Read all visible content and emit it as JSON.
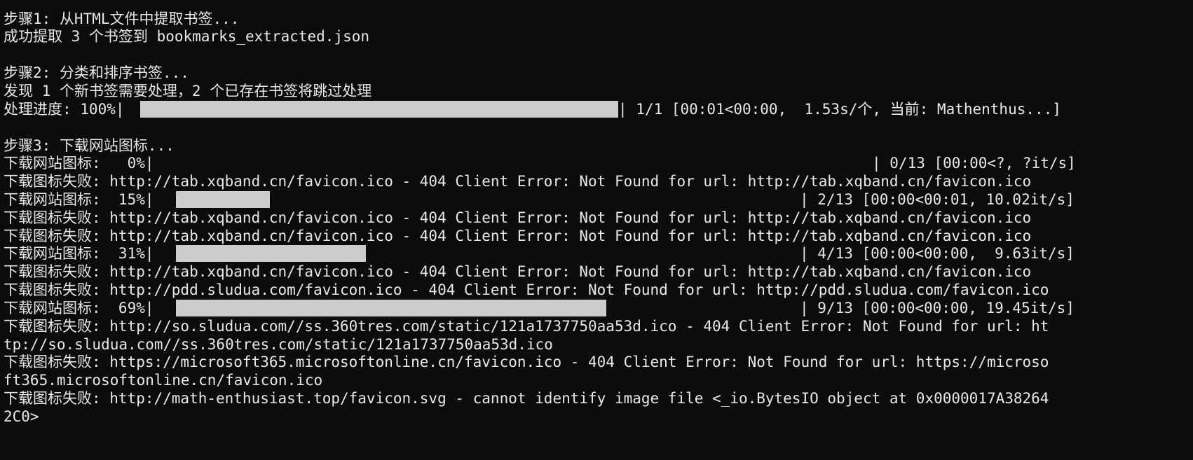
{
  "colors": {
    "background": "#0c0c0c",
    "text": "#e8e8e8",
    "progress_fill": "#cccccc"
  },
  "terminal": {
    "lines": {
      "step1": "步骤1: 从HTML文件中提取书签...",
      "extracted": "成功提取 3 个书签到 bookmarks_extracted.json",
      "step2": "步骤2: 分类和排序书签...",
      "found": "发现 1 个新书签需要处理，2 个已存在书签将跳过处理",
      "step3": "步骤3: 下载网站图标...",
      "fail1": "下载图标失败: http://tab.xqband.cn/favicon.ico - 404 Client Error: Not Found for url: http://tab.xqband.cn/favicon.ico",
      "fail2": "下载图标失败: http://tab.xqband.cn/favicon.ico - 404 Client Error: Not Found for url: http://tab.xqband.cn/favicon.ico",
      "fail3": "下载图标失败: http://tab.xqband.cn/favicon.ico - 404 Client Error: Not Found for url: http://tab.xqband.cn/favicon.ico",
      "fail4": "下载图标失败: http://tab.xqband.cn/favicon.ico - 404 Client Error: Not Found for url: http://tab.xqband.cn/favicon.ico",
      "fail5": "下载图标失败: http://pdd.sludua.com/favicon.ico - 404 Client Error: Not Found for url: http://pdd.sludua.com/favicon.ico",
      "fail6a": "下载图标失败: http://so.sludua.com//ss.360tres.com/static/121a1737750aa53d.ico - 404 Client Error: Not Found for url: ht",
      "fail6b": "tp://so.sludua.com//ss.360tres.com/static/121a1737750aa53d.ico",
      "fail7a": "下载图标失败: https://microsoft365.microsoftonline.cn/favicon.ico - 404 Client Error: Not Found for url: https://microso",
      "fail7b": "ft365.microsoftonline.cn/favicon.ico",
      "fail8a": "下载图标失败: http://math-enthusiast.top/favicon.svg - cannot identify image file <_io.BytesIO object at 0x0000017A38264",
      "fail8b": "2C0>"
    },
    "progress": {
      "process": {
        "label": "处理进度: 100%|",
        "fraction": 1.0,
        "stats": "| 1/1 [00:01<00:00,  1.53s/个, 当前: Mathenthus...]"
      },
      "dl0": {
        "label": "下载网站图标:   0%|",
        "fraction": 0.0,
        "stats": "| 0/13 [00:00<?, ?it/s]"
      },
      "dl15": {
        "label": "下载网站图标:  15%|",
        "fraction": 0.15,
        "stats": "| 2/13 [00:00<00:01, 10.02it/s]"
      },
      "dl31": {
        "label": "下载网站图标:  31%|",
        "fraction": 0.31,
        "stats": "| 4/13 [00:00<00:00,  9.63it/s]"
      },
      "dl69": {
        "label": "下载网站图标:  69%|",
        "fraction": 0.69,
        "stats": "| 9/13 [00:00<00:00, 19.45it/s]"
      }
    }
  }
}
